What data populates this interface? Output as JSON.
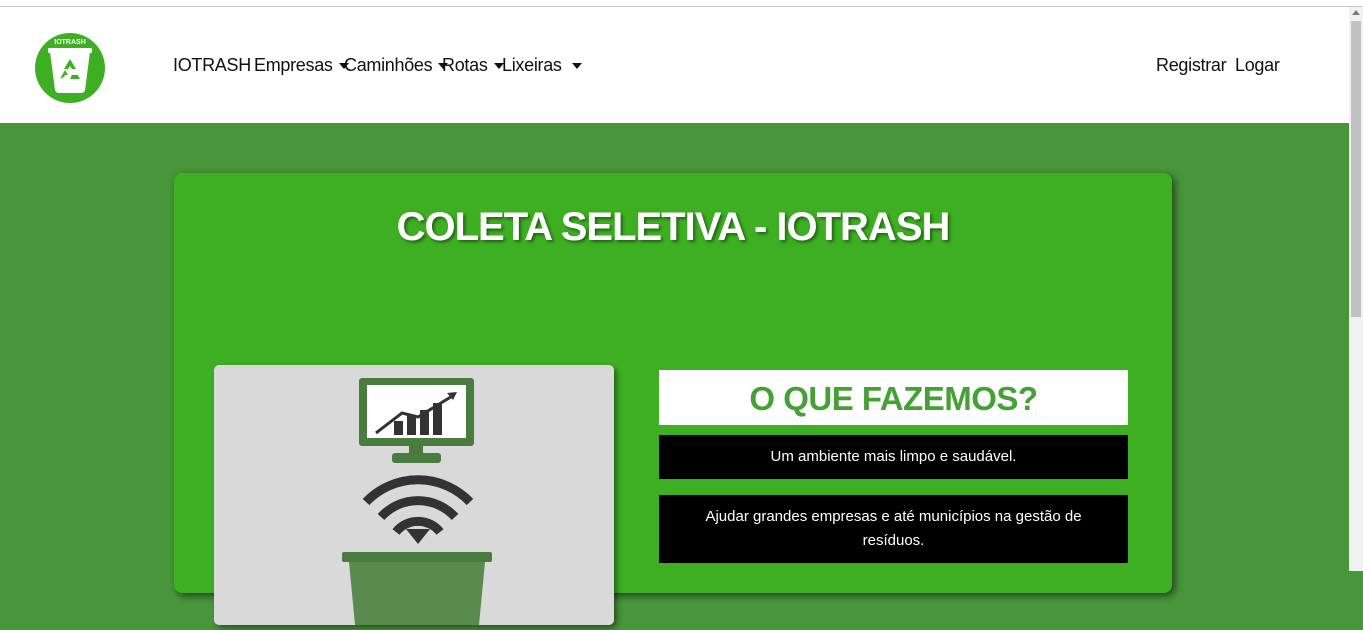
{
  "navbar": {
    "logo_text": "IOTRASH",
    "brand": "IOTRASH",
    "items": [
      {
        "label": "Empresas"
      },
      {
        "label": "Caminhões"
      },
      {
        "label": "Rotas"
      },
      {
        "label": "Lixeiras"
      }
    ],
    "register_label": "Registrar",
    "login_label": "Logar"
  },
  "hero": {
    "title": "COLETA SELETIVA - IOTRASH",
    "what_title": "O QUE FAZEMOS?",
    "info": [
      "Um ambiente mais limpo e saudável.",
      "Ajudar grandes empresas e até municípios na gestão de resíduos."
    ]
  },
  "colors": {
    "page_bg": "#48963a",
    "card_bg": "#3eaf23",
    "accent_green": "#45a135",
    "icon_dark": "#333333",
    "monitor_green": "#4a7c3f"
  },
  "icons": {
    "logo": "recycle-bin-icon",
    "illustration": [
      "monitor-chart-icon",
      "wifi-icon",
      "trash-bin-icon"
    ]
  }
}
